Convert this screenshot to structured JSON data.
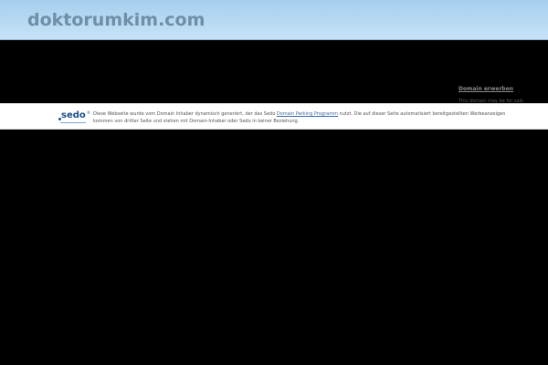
{
  "header": {
    "title": "doktorumkim.com"
  },
  "sidebar": {
    "acquire_link": "Domain erwerben",
    "sale_text": "This domain may be for sale"
  },
  "disclaimer": {
    "logo_text": "sedo",
    "logo_reg": "®",
    "text_before": "Diese Webseite wurde vom Domain Inhaber dynamisch generiert, der das Sedo ",
    "link_text": "Domain Parking Programm",
    "text_after": " nutzt. Die auf dieser Seite automatisiert bereitgestellten Werbeanzeigen kommen von dritter Seite und stehen mit Domain-Inhaber oder Sedo in keiner Beziehung.",
    "colors": {
      "logo": "#1b4f8a",
      "link": "#3a6aa8"
    }
  },
  "colors": {
    "header_gradient_top": "#a6cfee",
    "header_gradient_bottom": "#c6e2f6",
    "title": "#6f8ea8",
    "page_background": "#000000"
  }
}
